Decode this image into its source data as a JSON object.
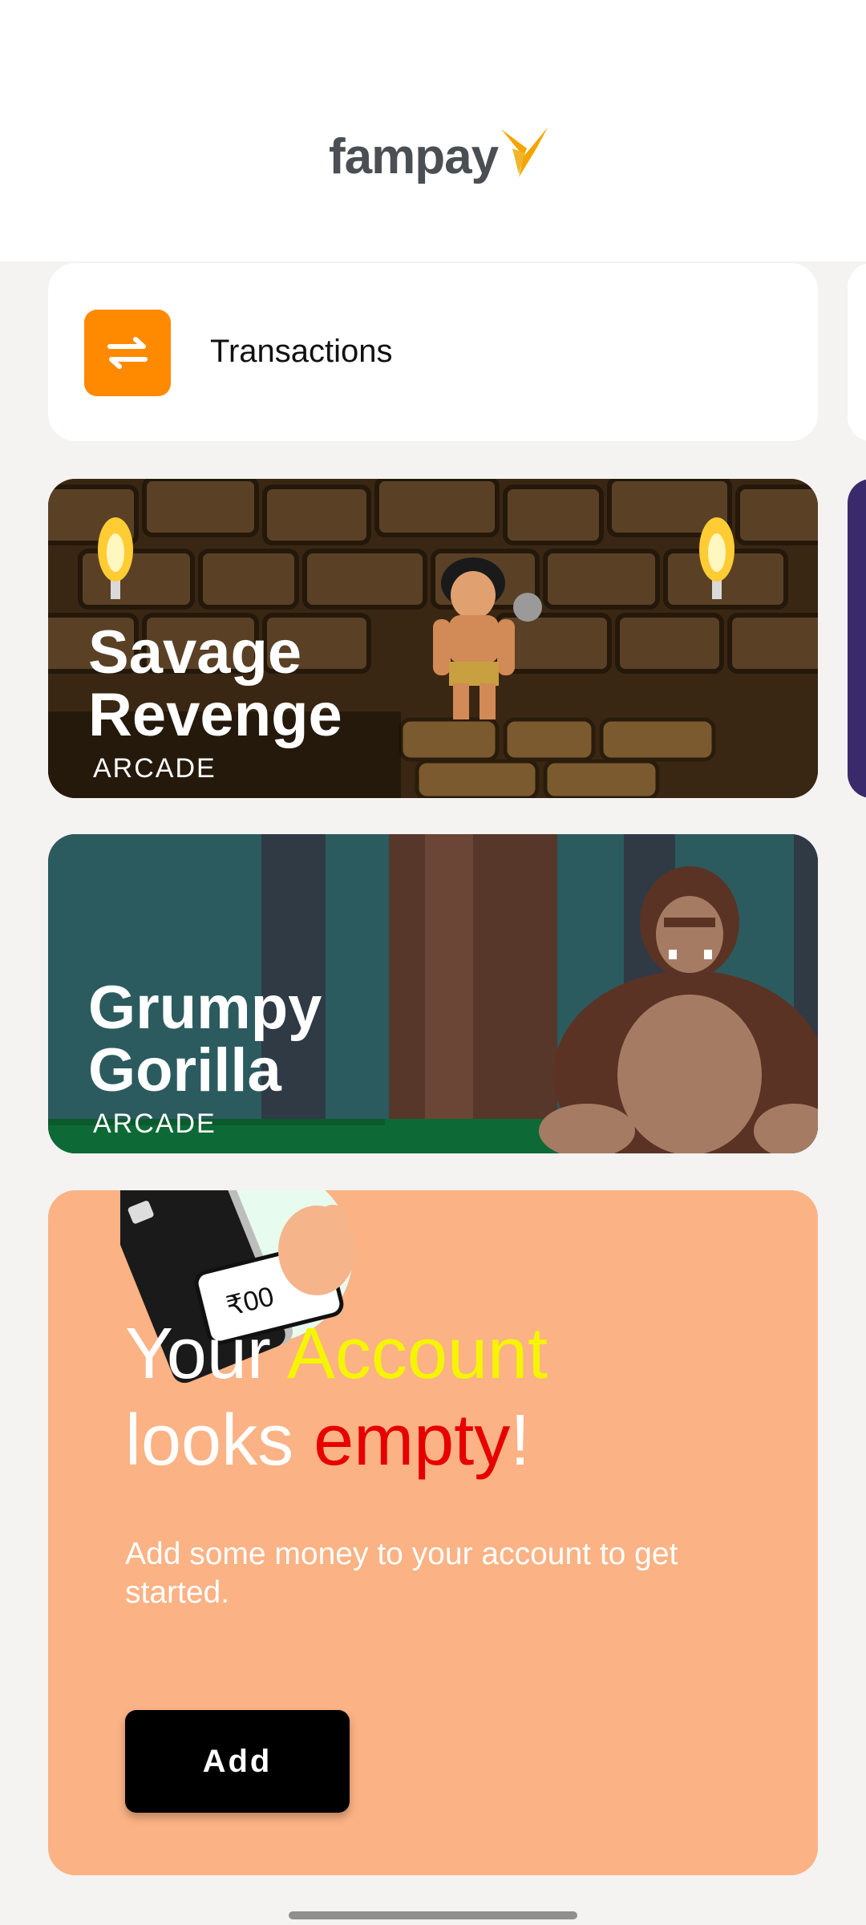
{
  "header": {
    "logo_text": "fampay",
    "logo_icon": "fampay-bird-icon",
    "brand_color": "#F5A400"
  },
  "quick_actions": {
    "transactions": {
      "label": "Transactions",
      "icon": "swap-arrows-icon",
      "icon_bg": "#FF8A00"
    }
  },
  "games": [
    {
      "title_line1": "Savage",
      "title_line2": "Revenge",
      "category": "ARCADE"
    },
    {
      "title_line1": "Grumpy",
      "title_line2": "Gorilla",
      "category": "ARCADE"
    }
  ],
  "promo": {
    "illus_amount": "₹00",
    "headline": {
      "word1": "Your ",
      "word2": "Account",
      "word3": "looks ",
      "word4": "empty",
      "word5": "!"
    },
    "subtitle": "Add some money to your account to get started.",
    "button_label": "Add",
    "bg_color": "#FBB284"
  }
}
